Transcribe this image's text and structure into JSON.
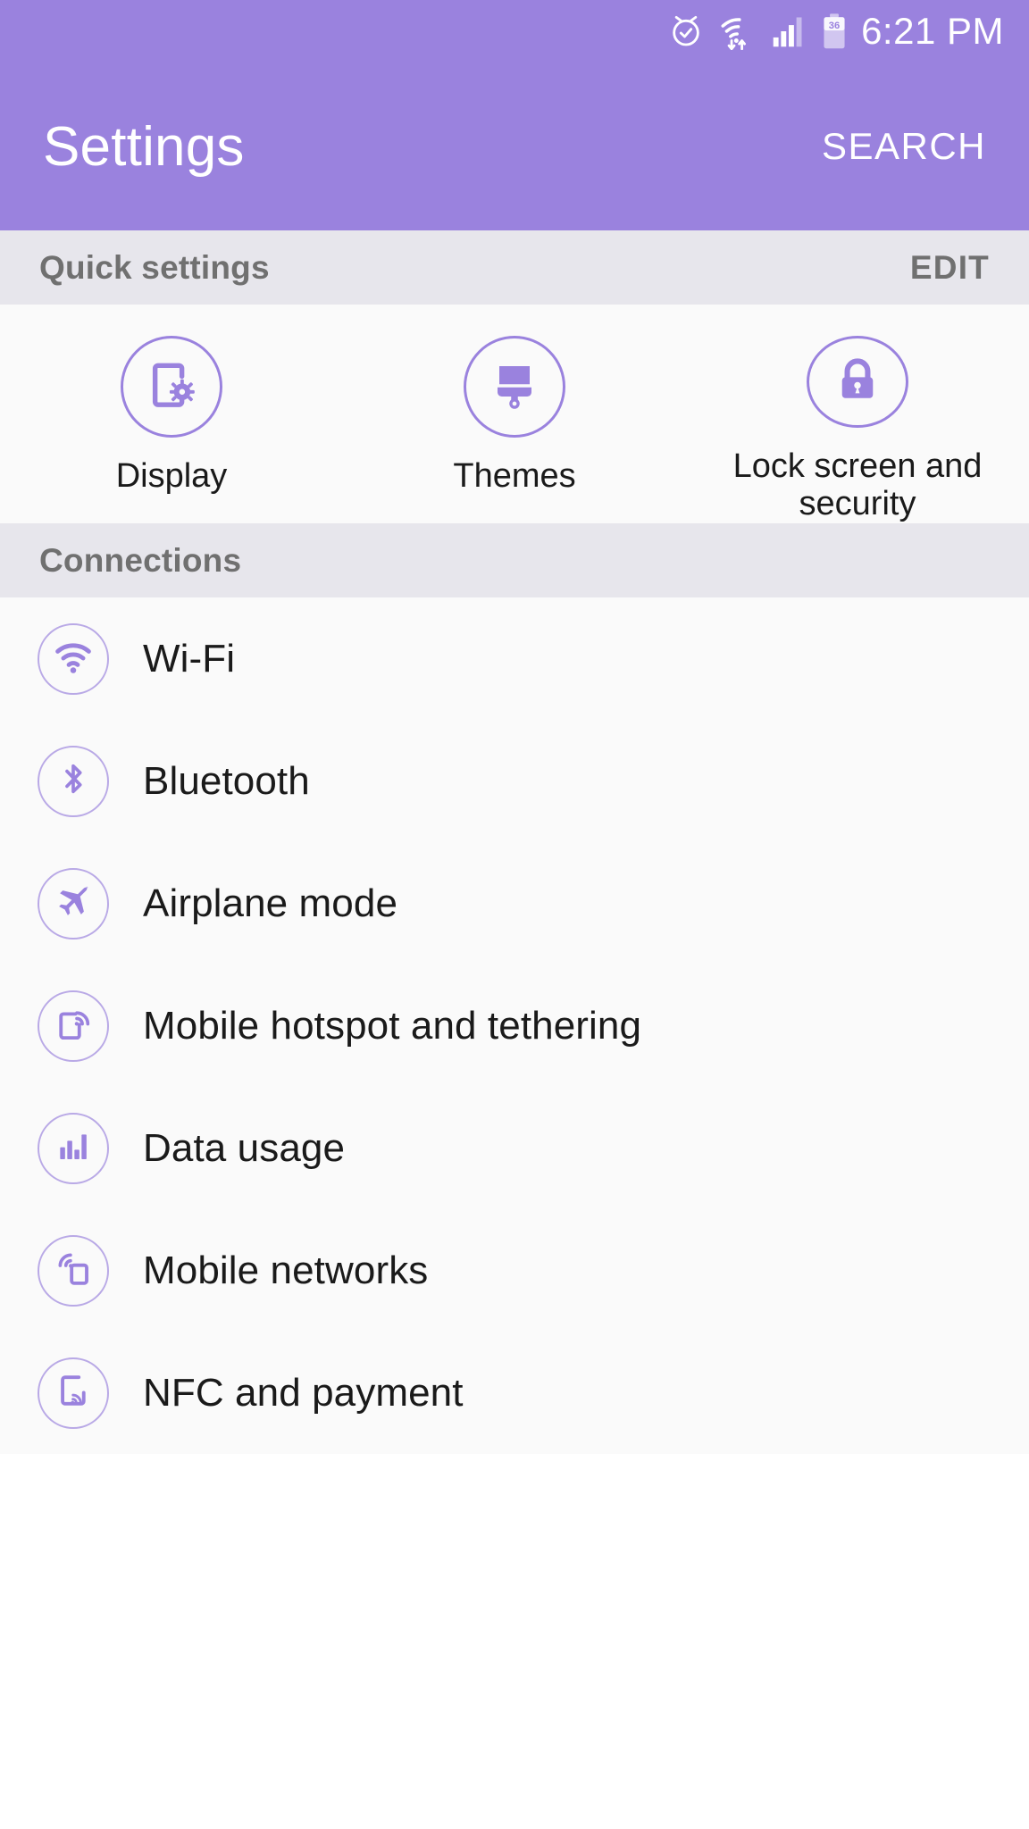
{
  "status_bar": {
    "time": "6:21 PM",
    "battery_level": "36",
    "icons": [
      "alarm-icon",
      "wifi-icon",
      "cellular-signal-icon",
      "battery-icon"
    ]
  },
  "app_bar": {
    "title": "Settings",
    "search_label": "SEARCH"
  },
  "quick_settings": {
    "header_title": "Quick settings",
    "edit_label": "EDIT",
    "items": [
      {
        "label": "Display",
        "icon": "display-settings-icon"
      },
      {
        "label": "Themes",
        "icon": "paintbrush-icon"
      },
      {
        "label": "Lock screen and security",
        "icon": "lock-icon"
      }
    ]
  },
  "connections": {
    "header_title": "Connections",
    "items": [
      {
        "label": "Wi-Fi",
        "icon": "wifi-icon"
      },
      {
        "label": "Bluetooth",
        "icon": "bluetooth-icon"
      },
      {
        "label": "Airplane mode",
        "icon": "airplane-icon"
      },
      {
        "label": "Mobile hotspot and tethering",
        "icon": "hotspot-icon"
      },
      {
        "label": "Data usage",
        "icon": "bar-chart-icon"
      },
      {
        "label": "Mobile networks",
        "icon": "mobile-networks-icon"
      },
      {
        "label": "NFC and payment",
        "icon": "nfc-icon"
      }
    ]
  },
  "colors": {
    "accent_purple": "#9a82de",
    "header_bar": "#e7e6ec",
    "page_background": "#fafafa",
    "text_primary": "#1a1a1a",
    "text_secondary": "#707070"
  }
}
